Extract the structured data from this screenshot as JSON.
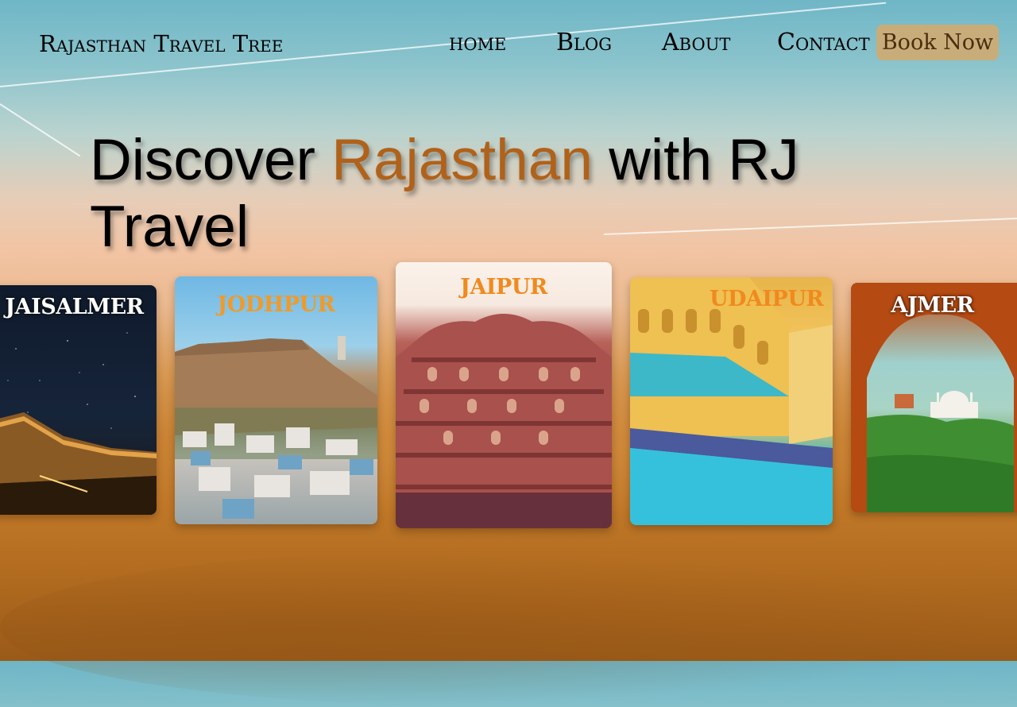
{
  "brand": "Rajasthan Travel Tree",
  "nav": {
    "home": "home",
    "blog": "Blog",
    "about": "About",
    "contact": "Contact",
    "book_now": "Book Now"
  },
  "hero": {
    "prefix": "Discover ",
    "accent": "Rajasthan",
    "suffix": " with RJ Travel"
  },
  "cities": [
    {
      "name": "JAISALMER"
    },
    {
      "name": "JODHPUR"
    },
    {
      "name": "JAIPUR"
    },
    {
      "name": "UDAIPUR"
    },
    {
      "name": "AJMER"
    }
  ],
  "colors": {
    "accent": "#b0621a",
    "button_bg": "#c8ad7a",
    "button_text": "#4a2e0f",
    "card_title_orange": "#f08a1e"
  }
}
